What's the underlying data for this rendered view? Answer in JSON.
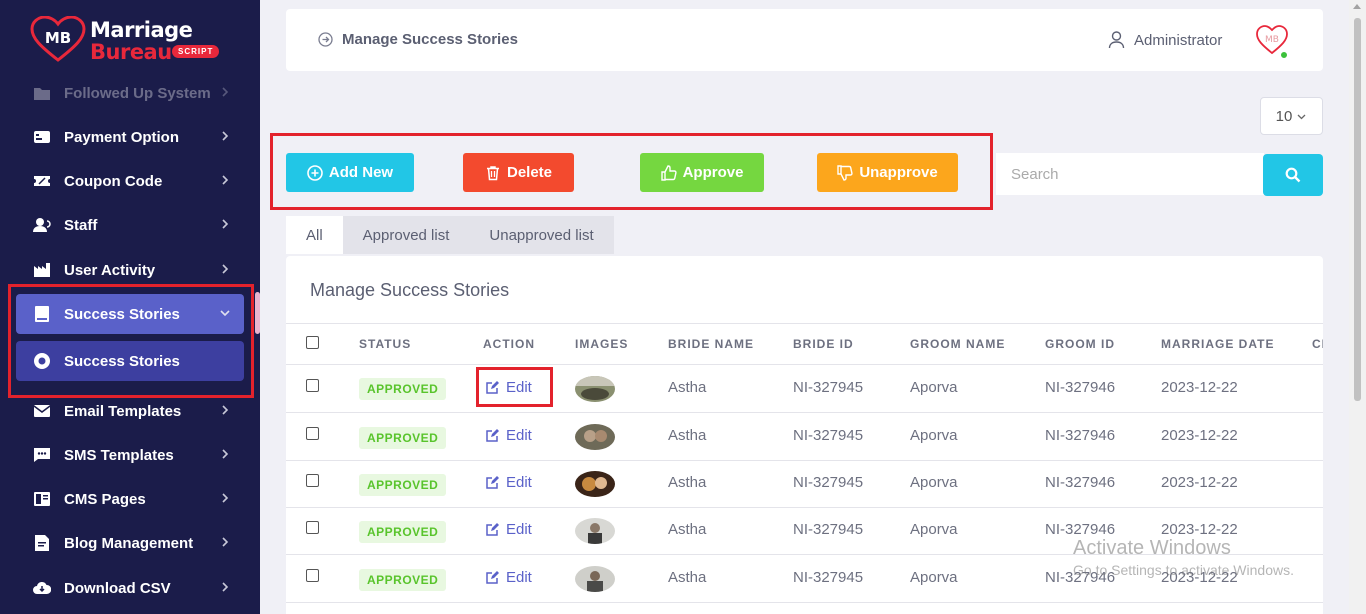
{
  "logo": {
    "line1": "Marriage",
    "line2": "Bureau",
    "badge": "SCRIPT",
    "mark_text": "MB"
  },
  "sidebar": {
    "items": [
      {
        "label": "Followed Up System",
        "icon": "folder-icon"
      },
      {
        "label": "Payment Option",
        "icon": "credit-card-icon"
      },
      {
        "label": "Coupon Code",
        "icon": "coupon-icon"
      },
      {
        "label": "Staff",
        "icon": "staff-icon"
      },
      {
        "label": "User Activity",
        "icon": "factory-icon"
      },
      {
        "label": "Success Stories",
        "icon": "book-icon"
      },
      {
        "label": "Success Stories",
        "icon": "circle-dot-icon"
      },
      {
        "label": "Email Templates",
        "icon": "envelope-icon"
      },
      {
        "label": "SMS Templates",
        "icon": "sms-icon"
      },
      {
        "label": "CMS Pages",
        "icon": "cms-icon"
      },
      {
        "label": "Blog Management",
        "icon": "blog-icon"
      },
      {
        "label": "Download CSV",
        "icon": "cloud-download-icon"
      }
    ]
  },
  "header": {
    "breadcrumb": "Manage Success Stories",
    "user_name": "Administrator"
  },
  "per_page": {
    "value": "10"
  },
  "toolbar": {
    "add_label": "Add New",
    "delete_label": "Delete",
    "approve_label": "Approve",
    "unapprove_label": "Unapprove",
    "search_placeholder": "Search"
  },
  "tabs": [
    {
      "label": "All"
    },
    {
      "label": "Approved list"
    },
    {
      "label": "Unapproved list"
    }
  ],
  "table": {
    "title": "Manage Success Stories",
    "headers": [
      "STATUS",
      "ACTION",
      "IMAGES",
      "BRIDE NAME",
      "BRIDE ID",
      "GROOM NAME",
      "GROOM ID",
      "MARRIAGE DATE",
      "CR"
    ],
    "rows": [
      {
        "status": "APPROVED",
        "action": "Edit",
        "bride_name": "Astha",
        "bride_id": "NI-327945",
        "groom_name": "Aporva",
        "groom_id": "NI-327946",
        "marriage_date": "2023-12-22"
      },
      {
        "status": "APPROVED",
        "action": "Edit",
        "bride_name": "Astha",
        "bride_id": "NI-327945",
        "groom_name": "Aporva",
        "groom_id": "NI-327946",
        "marriage_date": "2023-12-22"
      },
      {
        "status": "APPROVED",
        "action": "Edit",
        "bride_name": "Astha",
        "bride_id": "NI-327945",
        "groom_name": "Aporva",
        "groom_id": "NI-327946",
        "marriage_date": "2023-12-22"
      },
      {
        "status": "APPROVED",
        "action": "Edit",
        "bride_name": "Astha",
        "bride_id": "NI-327945",
        "groom_name": "Aporva",
        "groom_id": "NI-327946",
        "marriage_date": "2023-12-22"
      },
      {
        "status": "APPROVED",
        "action": "Edit",
        "bride_name": "Astha",
        "bride_id": "NI-327945",
        "groom_name": "Aporva",
        "groom_id": "NI-327946",
        "marriage_date": "2023-12-22"
      }
    ]
  },
  "watermark": {
    "line1": "Activate Windows",
    "line2": "Go to Settings to activate Windows."
  },
  "colors": {
    "sidebar_bg": "#1b1c4a",
    "accent": "#5a61c9",
    "highlight": "#e3222c",
    "add": "#22c6e6",
    "delete": "#f34a2e",
    "approve": "#75d740",
    "unapprove": "#fca61c"
  }
}
